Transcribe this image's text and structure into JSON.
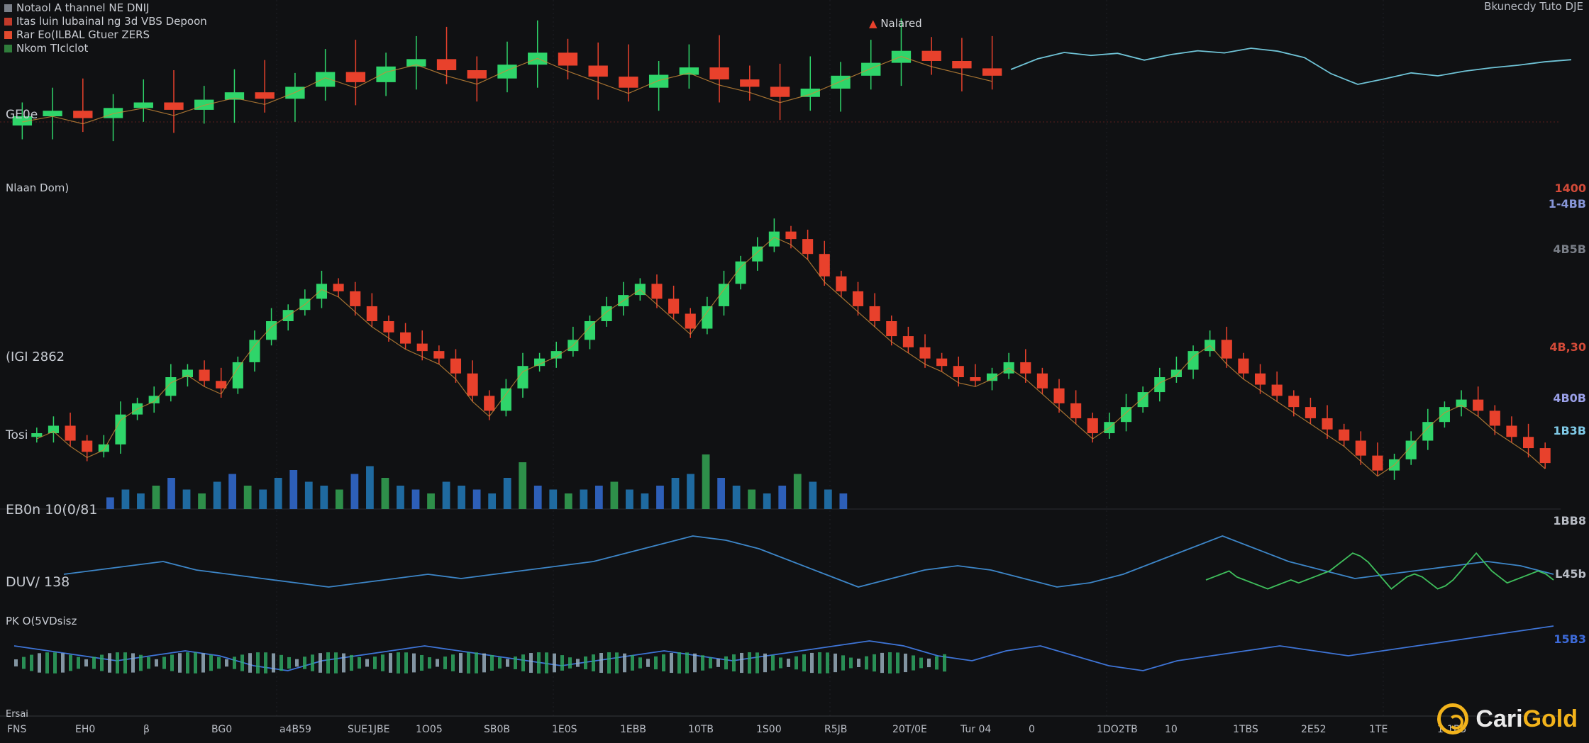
{
  "legend": [
    {
      "label": "Notaol A thannel NE DNIJ",
      "color": "#7a7f88"
    },
    {
      "label": "Itas luin lubainal ng 3d VBS Depoon",
      "color": "#c23a2a"
    },
    {
      "label": "Rar Eo(ILBAL Gtuer ZERS",
      "color": "#e24a2e"
    },
    {
      "label": "Nkom TIclclot",
      "color": "#2f7d3b"
    }
  ],
  "header_center": "Nalared",
  "header_right": "Bkunecdy Tuto DJE",
  "panel_labels": {
    "top": "GE0e",
    "mid": "Nlaan Dom)",
    "mid_price": "(IGI 2862",
    "mid_low": "Tosi",
    "volume": "EB0n 10(0/81",
    "osc1": "DUV/ 138",
    "osc2": "PK O(5VDsisz",
    "bottom": "Ersai"
  },
  "right_axis": [
    {
      "label": "1400",
      "color": "#d24a38"
    },
    {
      "label": "1-4BB",
      "color": "#8796d8"
    },
    {
      "label": "4B5B",
      "color": "#7a7f88"
    },
    {
      "label": "4B,30",
      "color": "#d24a38"
    },
    {
      "label": "4B0B",
      "color": "#9aa0e8"
    },
    {
      "label": "1B3B",
      "color": "#7fc9e6"
    },
    {
      "label": "1BB8",
      "color": "#b8bcc4"
    },
    {
      "label": "L45b",
      "color": "#b8bcc4"
    },
    {
      "label": "15B3",
      "color": "#3d6ad8"
    }
  ],
  "x_ticks": [
    "FNS",
    "EH0",
    "β",
    "BG0",
    "a4B59",
    "SUE1JBE",
    "1O05",
    "SB0B",
    "1E0S",
    "1EBB",
    "10TB",
    "1S00",
    "R5JB",
    "20T/0E",
    "Tur 04",
    "0",
    "1DO2TB",
    "10",
    "1TBS",
    "2E52",
    "1TE",
    "1-1B5"
  ],
  "logo": {
    "first": "Cari",
    "second": "Gold"
  },
  "colors": {
    "up": "#2fd56a",
    "down": "#e8412c",
    "line_cyan": "#6fc3d6",
    "line_blue": "#3e74d6",
    "ma_orange": "#c98a3a",
    "grid": "#1e2024"
  },
  "chart_data": [
    {
      "type": "candlestick",
      "title": "Nalared",
      "panel": "top",
      "series": [
        {
          "name": "price",
          "values": [
            12.0,
            12.6,
            11.8,
            12.9,
            13.5,
            12.7,
            13.8,
            14.6,
            13.9,
            15.2,
            16.8,
            15.7,
            17.4,
            18.2,
            17.0,
            16.1,
            17.6,
            18.9,
            17.5,
            16.3,
            15.1,
            16.5,
            17.3,
            16.0,
            15.2,
            14.1,
            15.0,
            16.4,
            17.8,
            19.1,
            18.0,
            17.2,
            16.4
          ]
        },
        {
          "name": "close_line",
          "values": [
            17.0,
            19.5,
            21.0,
            20.3,
            20.8,
            19.2,
            20.5,
            21.4,
            20.9,
            22.0,
            21.3,
            19.8,
            16.0,
            13.5,
            14.8,
            16.2,
            15.5,
            16.6,
            17.4,
            18.0,
            18.8,
            19.3
          ]
        }
      ]
    },
    {
      "type": "candlestick",
      "panel": "mid",
      "series": [
        {
          "name": "price",
          "values": [
            30,
            32,
            28,
            25,
            27,
            35,
            38,
            40,
            45,
            47,
            44,
            42,
            49,
            55,
            60,
            63,
            66,
            70,
            68,
            64,
            60,
            57,
            54,
            52,
            50,
            46,
            40,
            36,
            42,
            48,
            50,
            52,
            55,
            60,
            64,
            67,
            70,
            66,
            62,
            58,
            64,
            70,
            76,
            80,
            84,
            82,
            78,
            72,
            68,
            64,
            60,
            56,
            53,
            50,
            48,
            45,
            44,
            46,
            49,
            46,
            42,
            38,
            34,
            30,
            33,
            37,
            41,
            45,
            47,
            52,
            55,
            50,
            46,
            43,
            40,
            37,
            34,
            31,
            28,
            24,
            20,
            23,
            28,
            33,
            37,
            39,
            36,
            32,
            29,
            26,
            22
          ]
        },
        {
          "name": "volume",
          "values": [
            3,
            5,
            4,
            6,
            8,
            5,
            4,
            7,
            9,
            6,
            5,
            8,
            10,
            7,
            6,
            5,
            9,
            11,
            8,
            6,
            5,
            4,
            7,
            6,
            5,
            4,
            8,
            12,
            6,
            5,
            4,
            5,
            6,
            7,
            5,
            4,
            6,
            8,
            9,
            14,
            8,
            6,
            5,
            4,
            6,
            9,
            7,
            5,
            4
          ]
        }
      ]
    },
    {
      "type": "line",
      "panel": "osc1",
      "series": [
        {
          "name": "osc",
          "values": [
            0,
            1,
            2,
            3,
            1,
            0,
            -1,
            -2,
            -3,
            -2,
            -1,
            0,
            -1,
            0,
            1,
            2,
            3,
            5,
            7,
            9,
            8,
            6,
            3,
            0,
            -3,
            -1,
            1,
            2,
            1,
            -1,
            -3,
            -2,
            0,
            3,
            6,
            9,
            6,
            3,
            1,
            -1,
            0,
            1,
            2,
            3,
            2,
            0
          ]
        }
      ]
    },
    {
      "type": "line",
      "panel": "osc2",
      "series": [
        {
          "name": "osc",
          "values": [
            2,
            1,
            0,
            -1,
            0,
            1,
            0,
            -2,
            -3,
            -1,
            0,
            1,
            2,
            1,
            0,
            -1,
            -2,
            -1,
            0,
            1,
            0,
            -1,
            0,
            1,
            2,
            3,
            2,
            0,
            -1,
            1,
            2,
            0,
            -2,
            -3,
            -1,
            0,
            1,
            2,
            1,
            0,
            1,
            2,
            3,
            4,
            5,
            6
          ]
        }
      ]
    }
  ]
}
